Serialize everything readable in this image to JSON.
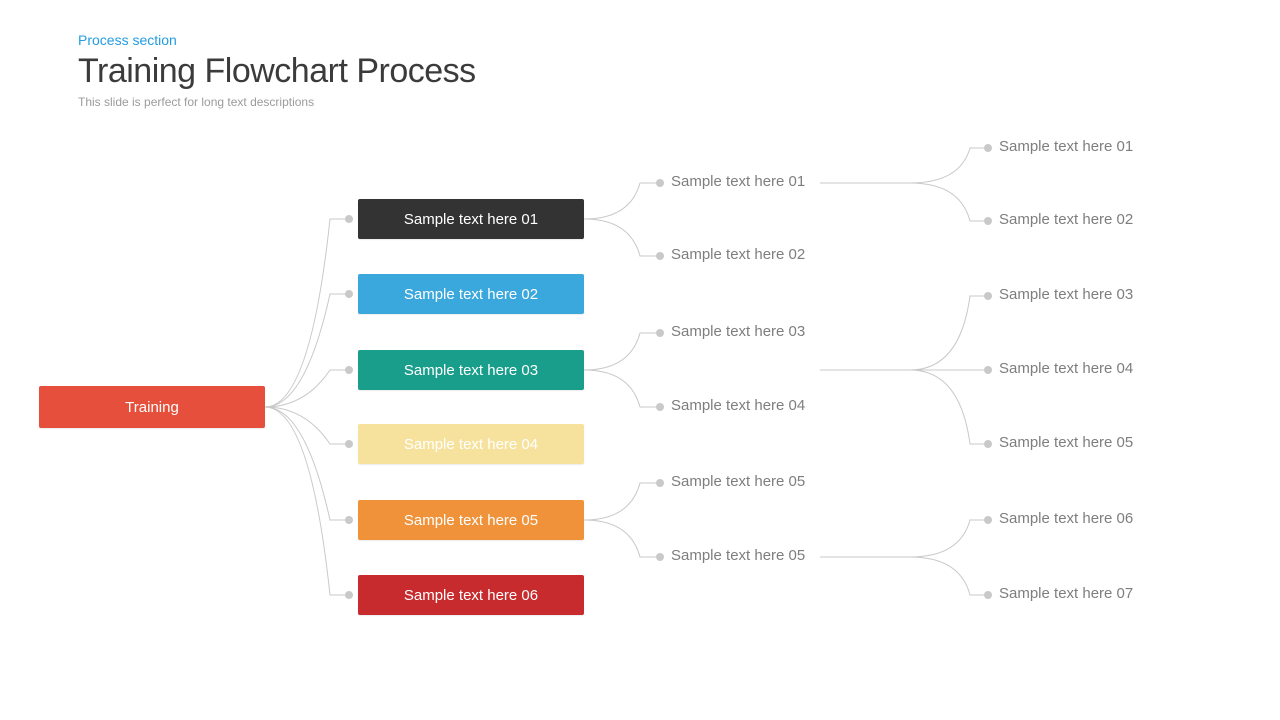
{
  "header": {
    "section": "Process section",
    "title": "Training Flowchart Process",
    "subtitle": "This slide is perfect for long text descriptions"
  },
  "root": {
    "label": "Training",
    "color": "#e64f3b"
  },
  "level2": [
    {
      "label": "Sample text here 01",
      "color": "#333333"
    },
    {
      "label": "Sample text here 02",
      "color": "#3aa8dd"
    },
    {
      "label": "Sample text here 03",
      "color": "#1a9e8c"
    },
    {
      "label": "Sample text here 04",
      "color": "#f7e29d"
    },
    {
      "label": "Sample text here 05",
      "color": "#ef923a"
    },
    {
      "label": "Sample text here 06",
      "color": "#c72b2d"
    }
  ],
  "level3": {
    "g0": [
      "Sample text here 01",
      "Sample text here 02"
    ],
    "g1": [
      "Sample text here 03",
      "Sample text here 04"
    ],
    "g2": [
      "Sample text here 05",
      "Sample text here 05"
    ]
  },
  "level4": {
    "g0": [
      "Sample text here 01",
      "Sample text here 02"
    ],
    "g1": [
      "Sample text here 03",
      "Sample text here 04",
      "Sample text here 05"
    ],
    "g2": [
      "Sample text here 06",
      "Sample text here 07"
    ]
  }
}
